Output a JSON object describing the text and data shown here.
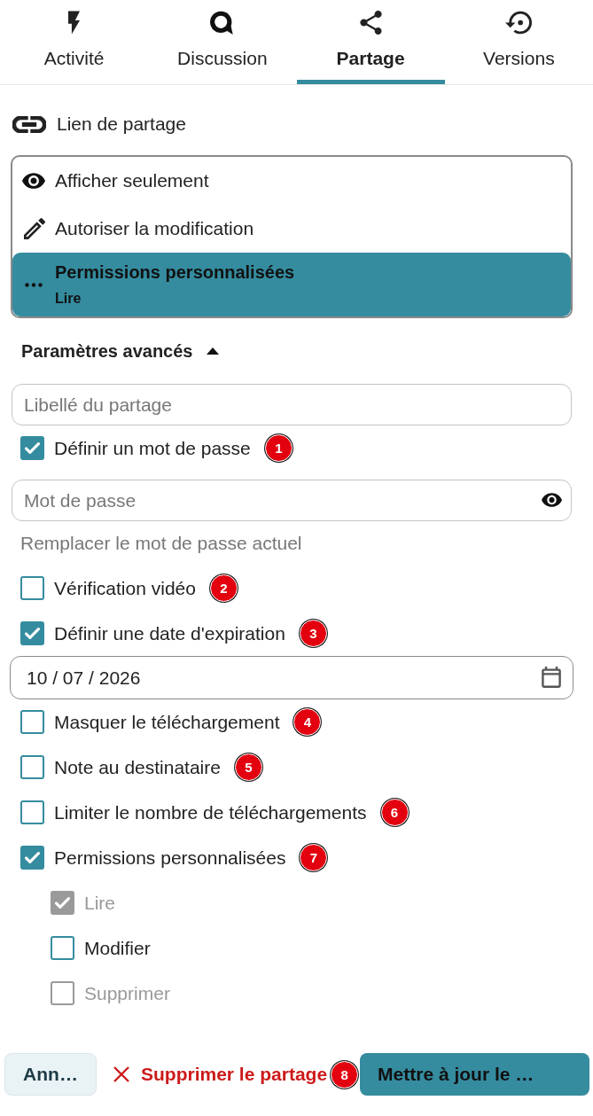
{
  "tabs": [
    {
      "label": "Activité",
      "selected": false
    },
    {
      "label": "Discussion",
      "selected": false
    },
    {
      "label": "Partage",
      "selected": true
    },
    {
      "label": "Versions",
      "selected": false
    }
  ],
  "share_link": {
    "label": "Lien de partage"
  },
  "permission_menu": {
    "options": [
      {
        "label": "Afficher seulement",
        "selected": false
      },
      {
        "label": "Autoriser la modification",
        "selected": false
      },
      {
        "label": "Permissions personnalisées",
        "subtitle": "Lire",
        "selected": true
      }
    ]
  },
  "advanced": {
    "title": "Paramètres avancés",
    "expanded": true
  },
  "share_label_field": {
    "placeholder": "Libellé du partage"
  },
  "settings": [
    {
      "kind": "checkbox",
      "label": "Définir un mot de passe",
      "checked": true,
      "marker": "1"
    },
    {
      "kind": "password",
      "placeholder": "Mot de passe"
    },
    {
      "kind": "hint",
      "text": "Remplacer le mot de passe actuel"
    },
    {
      "kind": "checkbox",
      "label": "Vérification vidéo",
      "checked": false,
      "marker": "2"
    },
    {
      "kind": "checkbox",
      "label": "Définir une date d'expiration",
      "checked": true,
      "marker": "3"
    },
    {
      "kind": "date",
      "value": "10 / 07 / 2026"
    },
    {
      "kind": "checkbox",
      "label": "Masquer le téléchargement",
      "checked": false,
      "marker": "4"
    },
    {
      "kind": "checkbox",
      "label": "Note au destinataire",
      "checked": false,
      "marker": "5"
    },
    {
      "kind": "checkbox",
      "label": "Limiter le nombre de téléchargements",
      "checked": false,
      "marker": "6"
    },
    {
      "kind": "checkbox",
      "label": "Permissions personnalisées",
      "checked": true,
      "marker": "7",
      "children": [
        {
          "label": "Lire",
          "checked": true,
          "disabled": true
        },
        {
          "label": "Modifier",
          "checked": false,
          "disabled": false
        },
        {
          "label": "Supprimer",
          "checked": false,
          "disabled": true
        }
      ]
    }
  ],
  "footer": {
    "cancel": "Ann…",
    "delete": {
      "label": "Supprimer le partage",
      "marker": "8"
    },
    "update": "Mettre à jour le …"
  }
}
